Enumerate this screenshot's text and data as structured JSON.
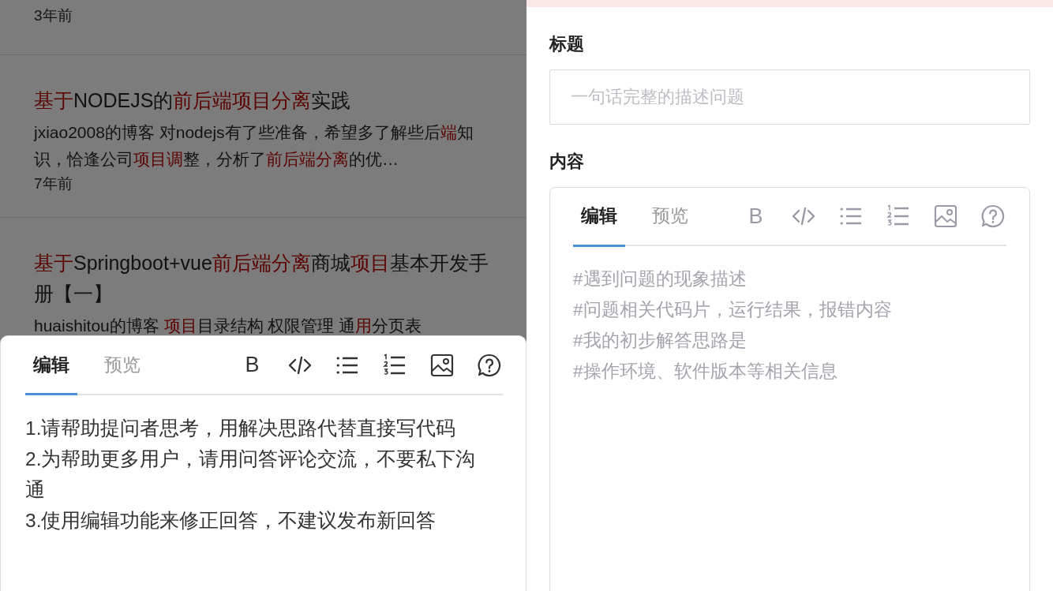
{
  "search_results": [
    {
      "time": "3年前"
    },
    {
      "title": [
        {
          "text": "基于",
          "highlight": true
        },
        {
          "text": "NODEJS的",
          "highlight": false
        },
        {
          "text": "前后端项目分离",
          "highlight": true
        },
        {
          "text": "实践",
          "highlight": false
        }
      ],
      "snippet": [
        {
          "text": "jxiao2008的博客  对nodejs有了些准备，希望多了解些后",
          "highlight": false
        },
        {
          "text": "端",
          "highlight": true
        },
        {
          "text": "知识，恰逢公司",
          "highlight": false
        },
        {
          "text": "项目调",
          "highlight": true
        },
        {
          "text": "整，分析了",
          "highlight": false
        },
        {
          "text": "前后端分离",
          "highlight": true
        },
        {
          "text": "的优…",
          "highlight": false
        }
      ],
      "time": "7年前"
    },
    {
      "title": [
        {
          "text": "基于",
          "highlight": true
        },
        {
          "text": "Springboot+vue",
          "highlight": false
        },
        {
          "text": "前后端分离",
          "highlight": true
        },
        {
          "text": "商城",
          "highlight": false
        },
        {
          "text": "项目",
          "highlight": true
        },
        {
          "text": "基本开发手册【一】",
          "highlight": false
        }
      ],
      "snippet": [
        {
          "text": "huaishitou的博客 ",
          "highlight": false
        },
        {
          "text": "项目",
          "highlight": true
        },
        {
          "text": "目录结构 权限管理 通",
          "highlight": false
        },
        {
          "text": "用",
          "highlight": true
        },
        {
          "text": "分页表",
          "highlight": false
        }
      ]
    }
  ],
  "answer_editor": {
    "tabs": [
      {
        "label": "编辑",
        "selected": true
      },
      {
        "label": "预览",
        "selected": false
      }
    ],
    "tools": [
      {
        "kind": "bold",
        "glyph": "B"
      },
      {
        "kind": "code"
      },
      {
        "kind": "bullets"
      },
      {
        "kind": "numbers"
      },
      {
        "kind": "image"
      },
      {
        "kind": "help"
      }
    ],
    "guidelines": [
      "1.请帮助提问者思考，用解决思路代替直接写代码",
      "2.为帮助更多用户，请用问答评论交流，不要私下沟通",
      "3.使用编辑功能来修正回答，不建议发布新回答"
    ]
  },
  "question_form": {
    "title_label": "标题",
    "title_placeholder": "一句话完整的描述问题",
    "content_label": "内容",
    "editor": {
      "tabs": [
        {
          "label": "编辑",
          "selected": true
        },
        {
          "label": "预览",
          "selected": false
        }
      ],
      "tools": [
        {
          "kind": "bold",
          "glyph": "B"
        },
        {
          "kind": "code"
        },
        {
          "kind": "bullets"
        },
        {
          "kind": "numbers"
        },
        {
          "kind": "image"
        },
        {
          "kind": "help"
        }
      ],
      "placeholder": "#遇到问题的现象描述\n#问题相关代码片，运行结果，报错内容\n#我的初步解答思路是\n#操作环境、软件版本等相关信息"
    }
  }
}
